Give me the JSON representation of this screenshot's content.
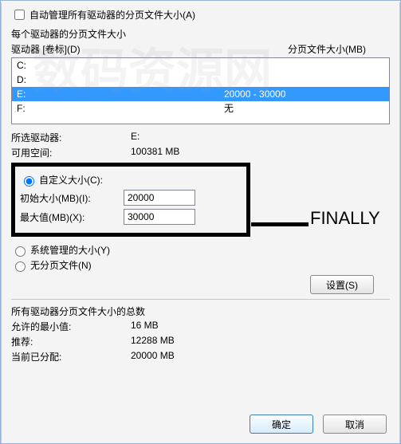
{
  "auto_manage": {
    "label": "自动管理所有驱动器的分页文件大小(A)",
    "checked": false
  },
  "section_title": "每个驱动器的分页文件大小",
  "columns": {
    "drive": "驱动器 [卷标](D)",
    "pagefile": "分页文件大小(MB)"
  },
  "drives": [
    {
      "letter": "C:",
      "pagefile": ""
    },
    {
      "letter": "D:",
      "pagefile": ""
    },
    {
      "letter": "E:",
      "pagefile": "20000 - 30000",
      "selected": true
    },
    {
      "letter": "F:",
      "pagefile": "无"
    }
  ],
  "selected_drive": {
    "label": "所选驱动器:",
    "value": "E:"
  },
  "free_space": {
    "label": "可用空间:",
    "value": "100381 MB"
  },
  "custom": {
    "radio_label": "自定义大小(C):",
    "initial_label": "初始大小(MB)(I):",
    "initial_value": "20000",
    "max_label": "最大值(MB)(X):",
    "max_value": "30000"
  },
  "system_managed": {
    "label": "系统管理的大小(Y)"
  },
  "no_paging": {
    "label": "无分页文件(N)"
  },
  "set_button": "设置(S)",
  "totals": {
    "title": "所有驱动器分页文件大小的总数",
    "min": {
      "label": "允许的最小值:",
      "value": "16 MB"
    },
    "recommended": {
      "label": "推荐:",
      "value": "12288 MB"
    },
    "current": {
      "label": "当前已分配:",
      "value": "20000 MB"
    }
  },
  "buttons": {
    "ok": "确定",
    "cancel": "取消"
  },
  "annotation": "FINALLY",
  "watermark": "数码资源网"
}
